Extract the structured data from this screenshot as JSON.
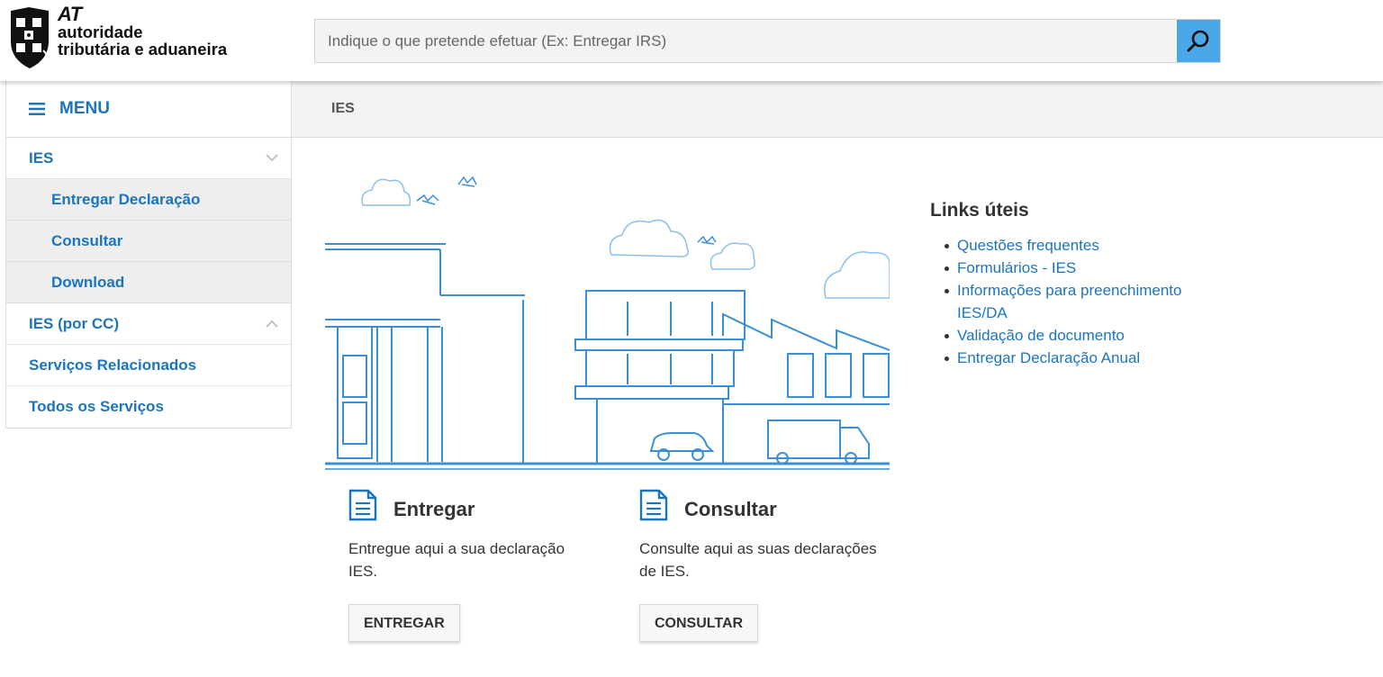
{
  "header": {
    "logo": {
      "line1": "AT",
      "line2": "autoridade",
      "line3": "tributária e aduaneira"
    },
    "search": {
      "placeholder": "Indique o que pretende efetuar (Ex: Entregar IRS)"
    }
  },
  "breadcrumb": "IES",
  "sidebar": {
    "menu_label": "MENU",
    "items": [
      {
        "label": "IES",
        "expanded": true
      },
      {
        "label": "Entregar Declaração"
      },
      {
        "label": "Consultar"
      },
      {
        "label": "Download"
      },
      {
        "label": "IES (por CC)",
        "expanded": false
      },
      {
        "label": "Serviços Relacionados"
      },
      {
        "label": "Todos os Serviços"
      }
    ]
  },
  "cards": [
    {
      "title": "Entregar",
      "description": "Entregue aqui a sua declaração IES.",
      "button": "ENTREGAR",
      "icon": "document-icon"
    },
    {
      "title": "Consultar",
      "description": "Consulte aqui as suas declarações de IES.",
      "button": "CONSULTAR",
      "icon": "document-icon"
    }
  ],
  "links": {
    "title": "Links úteis",
    "items": [
      "Questões frequentes",
      "Formulários - IES",
      "Informações para preenchimento IES/DA",
      "Validação de documento",
      "Entregar Declaração Anual"
    ]
  },
  "colors": {
    "brand_blue": "#1c75bc",
    "search_button": "#4ba8e8",
    "illustration_line": "#3a8fd6"
  }
}
